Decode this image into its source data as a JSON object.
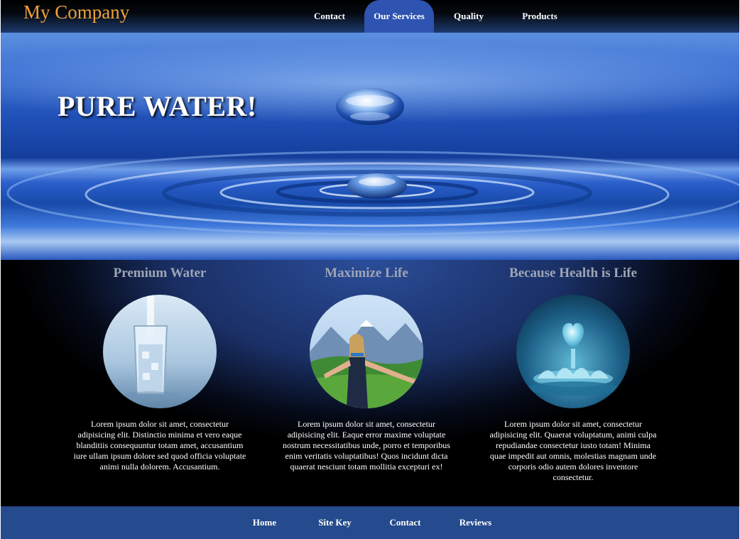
{
  "header": {
    "logo": "My Company",
    "nav": [
      "Contact",
      "Our Services",
      "Quality",
      "Products"
    ],
    "active_nav": "Our Services"
  },
  "hero": {
    "title": "PURE WATER!"
  },
  "features": [
    {
      "title": "Premium Water",
      "image": "glass-of-water-image",
      "text": "Lorem ipsum dolor sit amet, consectetur adipisicing elit. Distinctio minima et vero eaque blanditiis consequuntur totam amet, accusantium iure ullam ipsum dolore sed quod officia voluptate animi nulla dolorem. Accusantium."
    },
    {
      "title": "Maximize Life",
      "image": "happy-woman-mountains-image",
      "text": "Lorem ipsum dolor sit amet, consectetur adipisicing elit. Eaque error maxime voluptate nostrum necessitatibus unde, porro et temporibus enim veritatis voluptatibus! Quos incidunt dicta quaerat nesciunt totam mollitia excepturi ex!"
    },
    {
      "title": "Because Health is Life",
      "image": "water-heart-splash-image",
      "text": "Lorem ipsum dolor sit amet, consectetur adipisicing elit. Quaerat voluptatum, animi culpa repudiandae consectetur iusto totam! Minima quae impedit aut omnis, molestias magnam unde corporis odio autem dolores inventore consectetur."
    }
  ],
  "footer": {
    "nav": [
      "Home",
      "Site Key",
      "Contact",
      "Reviews"
    ]
  },
  "colors": {
    "logo": "#f0a238",
    "active_nav": "#2e53b0",
    "footer": "#254a8d",
    "feature_heading": "#9ea5b6"
  }
}
